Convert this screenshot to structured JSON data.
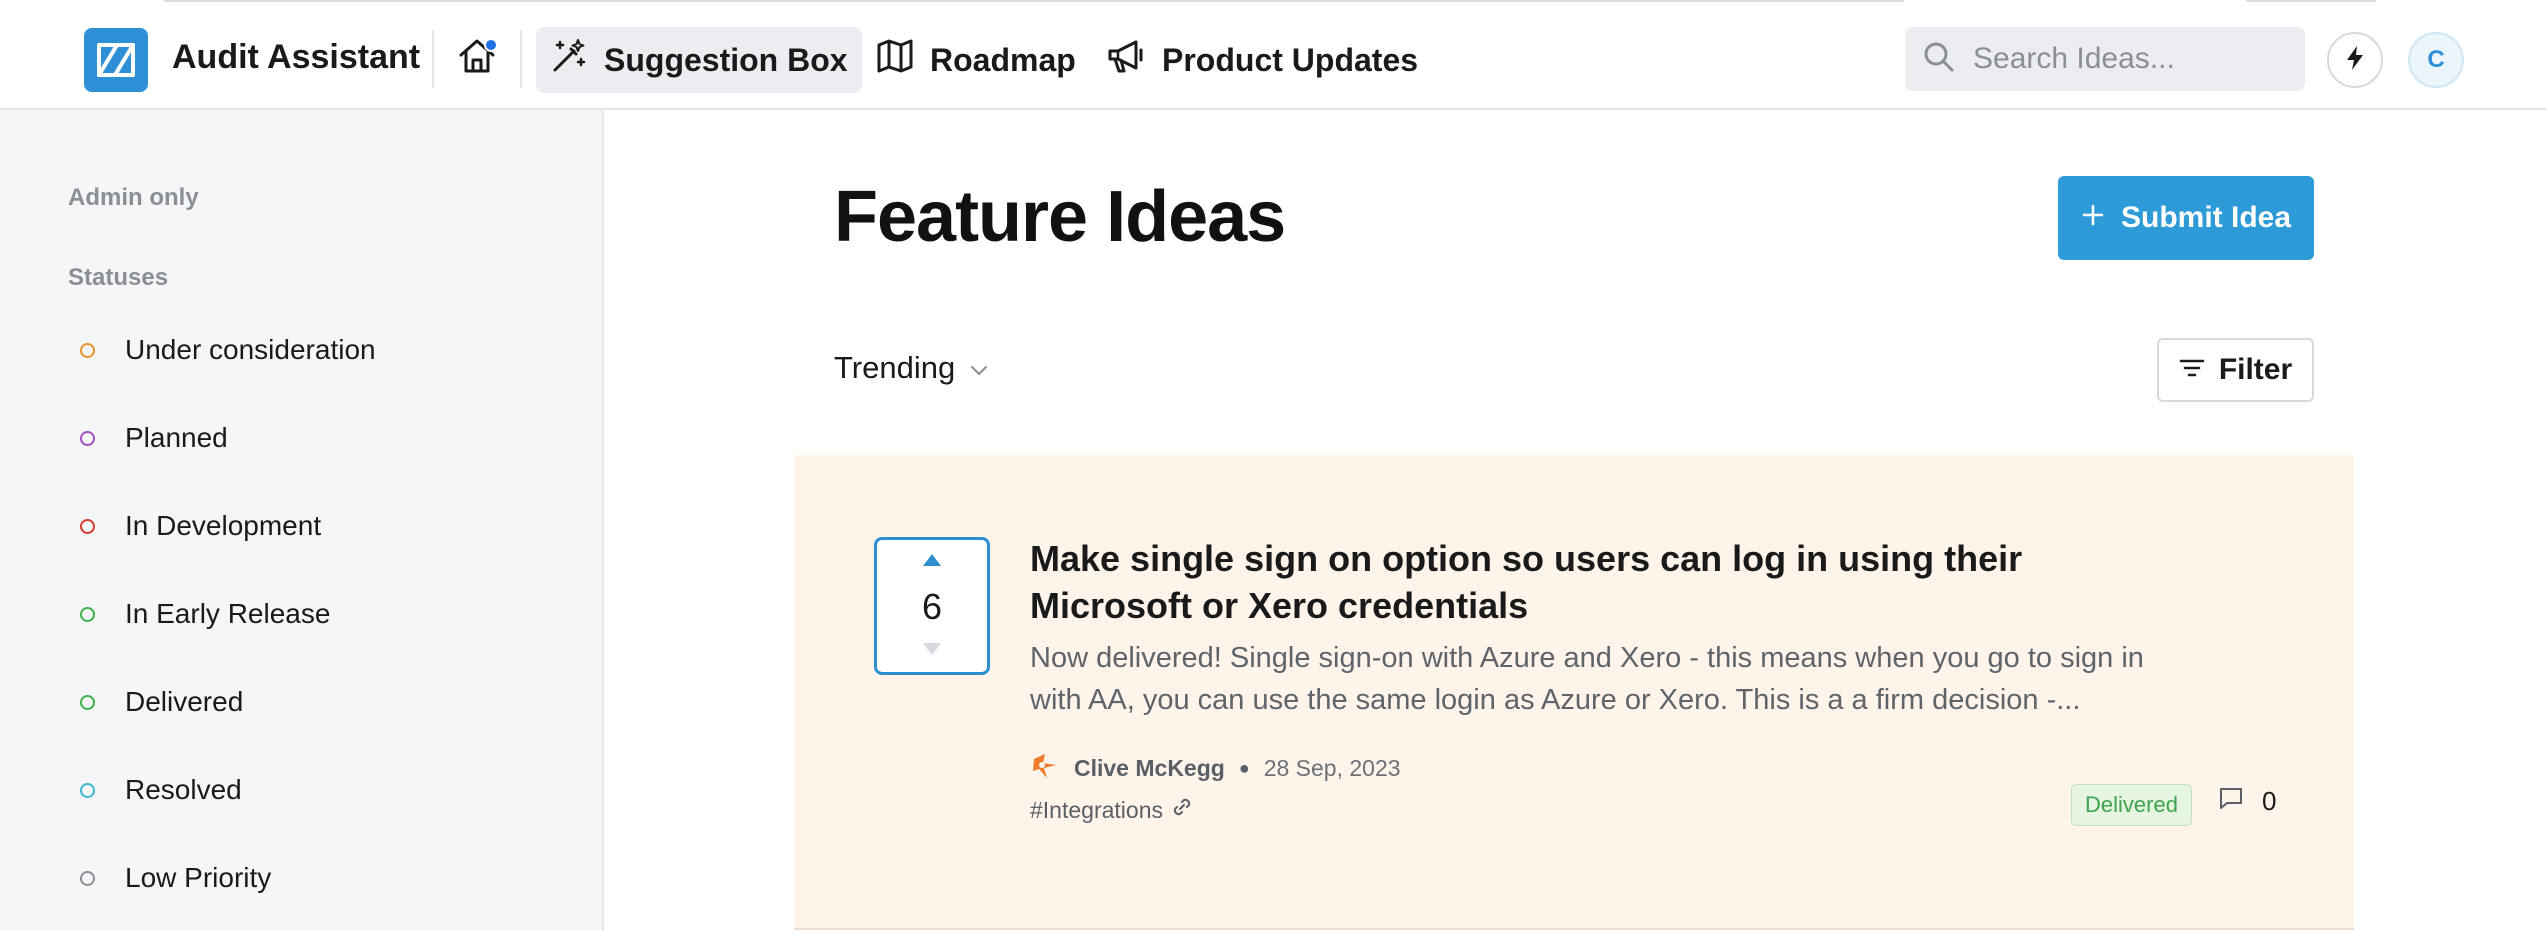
{
  "header": {
    "app_name": "Audit Assistant",
    "nav": [
      {
        "label": "Suggestion Box",
        "icon": "magic-wand-icon",
        "active": true
      },
      {
        "label": "Roadmap",
        "icon": "map-icon",
        "active": false
      },
      {
        "label": "Product Updates",
        "icon": "megaphone-icon",
        "active": false
      }
    ],
    "search_placeholder": "Search Ideas...",
    "avatar_initial": "C"
  },
  "sidebar": {
    "admin_label": "Admin only",
    "statuses_label": "Statuses",
    "statuses": [
      {
        "label": "Under consideration",
        "color": "#e8922c"
      },
      {
        "label": "Planned",
        "color": "#a24fc6"
      },
      {
        "label": "In Development",
        "color": "#d93a2b"
      },
      {
        "label": "In Early Release",
        "color": "#3fb24a"
      },
      {
        "label": "Delivered",
        "color": "#3fb24a"
      },
      {
        "label": "Resolved",
        "color": "#3cb8cf"
      },
      {
        "label": "Low Priority",
        "color": "#8a8f96"
      }
    ]
  },
  "main": {
    "title": "Feature Ideas",
    "submit_label": "Submit Idea",
    "sort_label": "Trending",
    "filter_label": "Filter",
    "ideas": [
      {
        "votes": "6",
        "title": "Make single sign on option so users can log in using their Microsoft or Xero credentials",
        "excerpt": "Now delivered! Single sign-on with Azure and Xero - this means when you go to sign in with AA, you can use the same login as Azure or Xero. This is a a firm decision -...",
        "author": "Clive McKegg",
        "date": "28 Sep, 2023",
        "tag": "#Integrations",
        "status": "Delivered",
        "comment_count": "0"
      }
    ]
  },
  "colors": {
    "brand": "#2f8fd6",
    "primary_button": "#2d9bd8",
    "card_background": "#fef4ea",
    "delivered_badge": "#3fa34d"
  }
}
